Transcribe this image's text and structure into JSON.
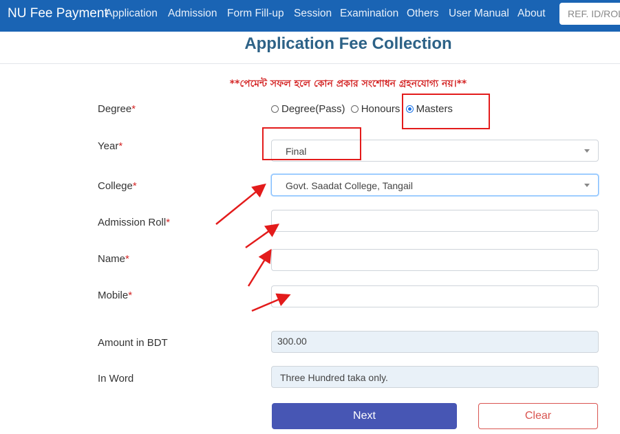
{
  "nav": {
    "brand": "NU Fee Payment",
    "items": [
      "Application",
      "Admission",
      "Form Fill-up",
      "Session",
      "Examination",
      "Others",
      "User Manual",
      "About"
    ],
    "search_placeholder": "REF. ID/ROLL"
  },
  "page": {
    "title": "Application Fee Collection",
    "notice": "**পেমেন্ট সফল হলে কোন প্রকার সংশোধন গ্রহনযোগ্য নয়।**"
  },
  "form": {
    "required_mark": "*",
    "degree": {
      "label": "Degree",
      "options": [
        "Degree(Pass)",
        "Honours",
        "Masters"
      ],
      "selected": "Masters"
    },
    "year": {
      "label": "Year",
      "value": "Final"
    },
    "college": {
      "label": "College",
      "value": "Govt. Saadat College, Tangail"
    },
    "admission_roll": {
      "label": "Admission Roll",
      "value": ""
    },
    "name": {
      "label": "Name",
      "value": ""
    },
    "mobile": {
      "label": "Mobile",
      "value": ""
    },
    "amount": {
      "label": "Amount in BDT",
      "value": "300.00"
    },
    "in_word": {
      "label": "In Word",
      "value": "Three Hundred taka only."
    }
  },
  "buttons": {
    "next": "Next",
    "clear": "Clear"
  },
  "colors": {
    "navbar": "#1a64b4",
    "title": "#2d6287",
    "required": "#d42525",
    "annotation": "#e31b1b",
    "next_button": "#4756b4"
  }
}
